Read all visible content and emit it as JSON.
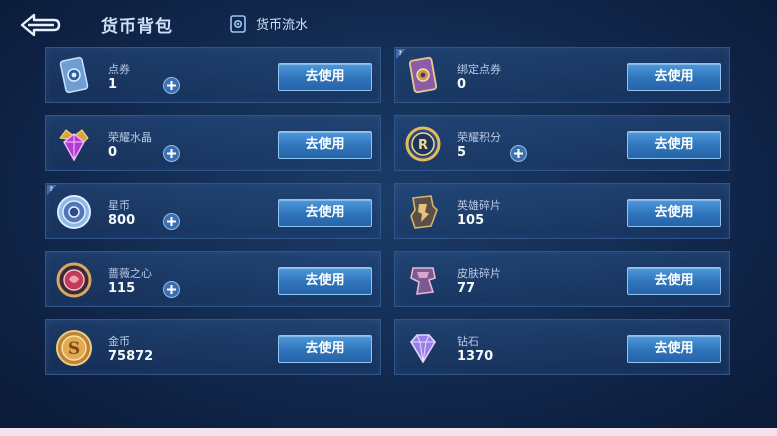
{
  "header": {
    "title": "货币背包",
    "flow_tab": "货币流水"
  },
  "use_label": "去使用",
  "currencies": [
    {
      "name": "点券",
      "value": "1",
      "icon": "ticket-card-icon",
      "has_plus": true,
      "has_help": false
    },
    {
      "name": "绑定点券",
      "value": "0",
      "icon": "bound-ticket-card-icon",
      "has_plus": false,
      "has_help": true
    },
    {
      "name": "荣耀水晶",
      "value": "0",
      "icon": "glory-crystal-icon",
      "has_plus": true,
      "has_help": false
    },
    {
      "name": "荣耀积分",
      "value": "5",
      "icon": "glory-points-icon",
      "has_plus": true,
      "has_help": false
    },
    {
      "name": "星币",
      "value": "800",
      "icon": "star-coin-icon",
      "has_plus": true,
      "has_help": true
    },
    {
      "name": "英雄碎片",
      "value": "105",
      "icon": "hero-shard-icon",
      "has_plus": false,
      "has_help": false
    },
    {
      "name": "蔷薇之心",
      "value": "115",
      "icon": "rose-heart-icon",
      "has_plus": true,
      "has_help": false
    },
    {
      "name": "皮肤碎片",
      "value": "77",
      "icon": "skin-shard-icon",
      "has_plus": false,
      "has_help": false
    },
    {
      "name": "金币",
      "value": "75872",
      "icon": "gold-coin-icon",
      "has_plus": false,
      "has_help": false
    },
    {
      "name": "钻石",
      "value": "1370",
      "icon": "diamond-icon",
      "has_plus": false,
      "has_help": false
    }
  ],
  "colors": {
    "background": "#142f56",
    "card_border": "#2f5589",
    "button": "#3a86cf",
    "bottom_strip": "#f3e3ec"
  }
}
